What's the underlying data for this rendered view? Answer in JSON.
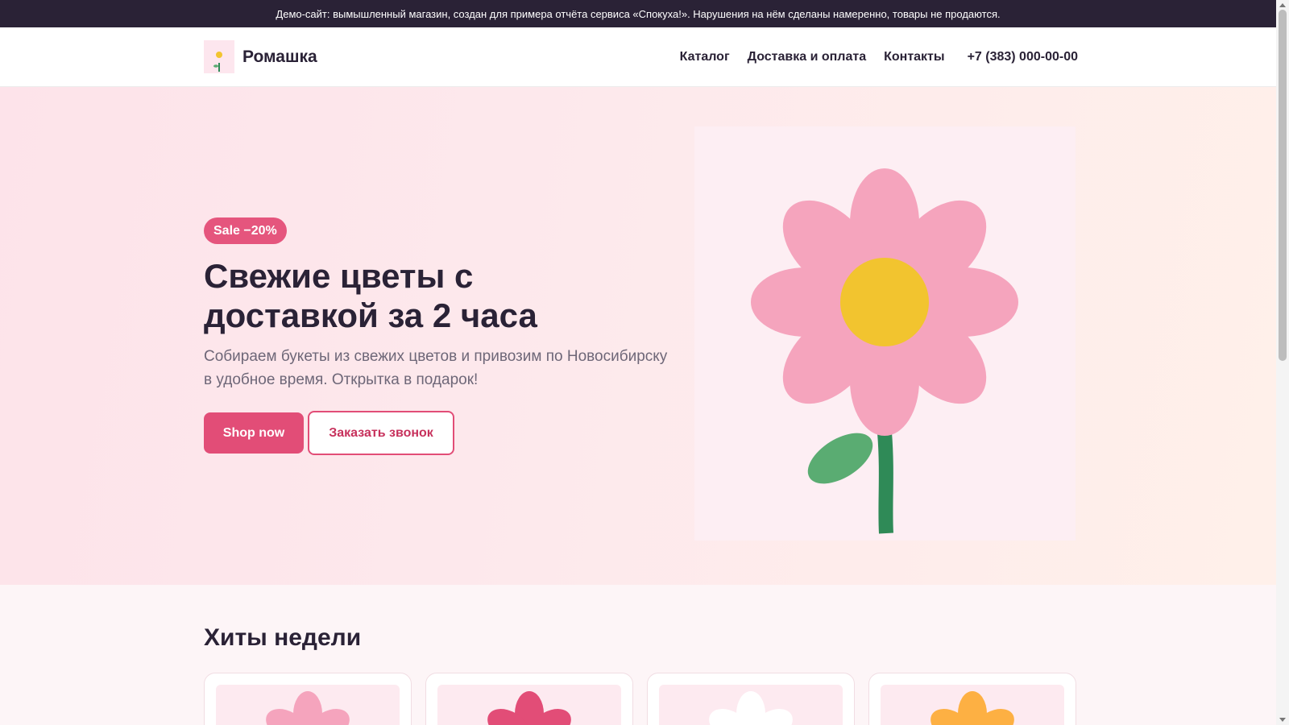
{
  "demo_notice": "Демо-сайт: вымышленный магазин, создан для примера отчёта сервиса «Спокуха!». Нарушения на нём сделаны намеренно, товары не продаются.",
  "header": {
    "logo_text": "Ромашка",
    "nav": [
      {
        "label": "Каталог"
      },
      {
        "label": "Доставка и оплата"
      },
      {
        "label": "Контакты"
      }
    ],
    "phone": "+7 (383) 000-00-00"
  },
  "hero": {
    "badge": "Sale −20%",
    "title": "Свежие цветы с доставкой за 2 часа",
    "subtitle": "Собираем букеты из свежих цветов и привозим по Новосибирску в удобное время. Открытка в подарок!",
    "primary_button": "Shop now",
    "secondary_button": "Заказать звонок"
  },
  "hits": {
    "title": "Хиты недели",
    "cards": [
      {
        "petal_color": "#f5a4bd"
      },
      {
        "petal_color": "#e24d77"
      },
      {
        "petal_color": "#ffffff"
      },
      {
        "petal_color": "#fdb043"
      }
    ]
  },
  "colors": {
    "accent": "#e24d77",
    "flower_petal": "#f5a4bd",
    "flower_center": "#f2c42f",
    "stem": "#2f8a57",
    "leaf": "#5aac72",
    "dark": "#2a2236"
  }
}
